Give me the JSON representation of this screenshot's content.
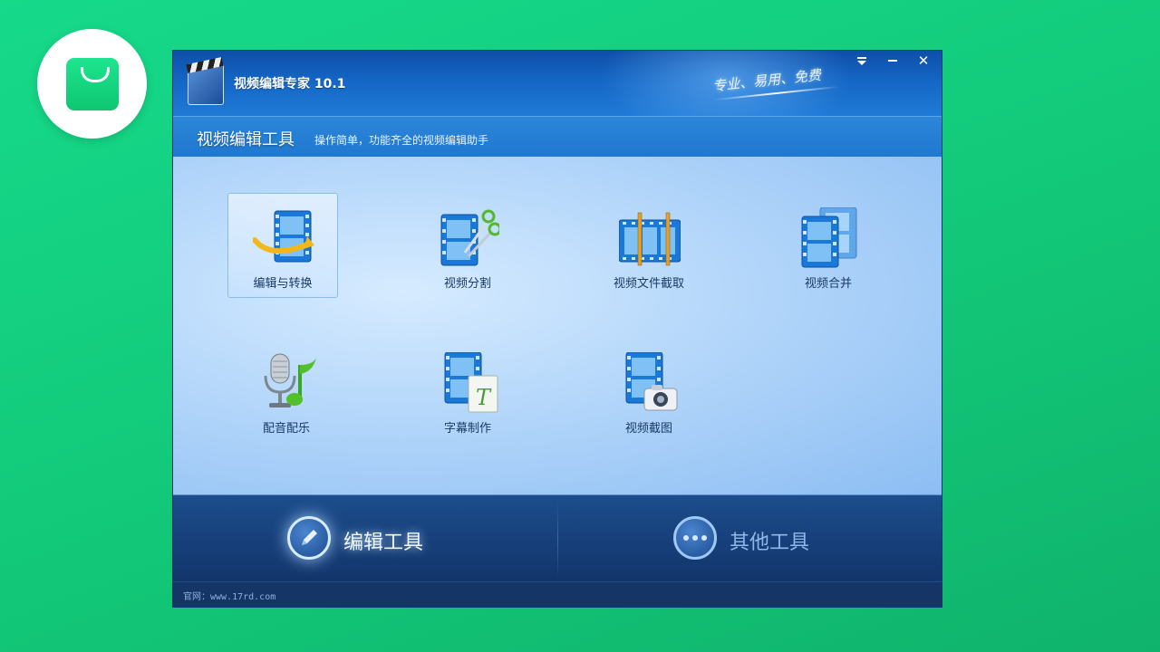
{
  "app": {
    "title": "视频编辑专家 10.1",
    "slogan": "专业、易用、免费"
  },
  "window_controls": {
    "dropdown_icon": "dropdown-arrow-icon",
    "minimize_icon": "minimize-icon",
    "close_label": "✕"
  },
  "header": {
    "title": "视频编辑工具",
    "subtitle": "操作简单，功能齐全的视频编辑助手"
  },
  "tools": [
    {
      "label": "编辑与转换",
      "icon": "film-convert-icon",
      "selected": true
    },
    {
      "label": "视频分割",
      "icon": "film-scissors-icon",
      "selected": false
    },
    {
      "label": "视频文件截取",
      "icon": "film-trim-icon",
      "selected": false
    },
    {
      "label": "视频合并",
      "icon": "film-merge-icon",
      "selected": false
    },
    {
      "label": "配音配乐",
      "icon": "microphone-music-icon",
      "selected": false
    },
    {
      "label": "字幕制作",
      "icon": "film-subtitle-icon",
      "selected": false
    },
    {
      "label": "视频截图",
      "icon": "film-camera-icon",
      "selected": false
    }
  ],
  "bottom_tabs": [
    {
      "label": "编辑工具",
      "icon": "pencil-icon",
      "active": true
    },
    {
      "label": "其他工具",
      "icon": "more-dots-icon",
      "active": false
    }
  ],
  "footer": {
    "website": "官网：www.17rd.com"
  },
  "colors": {
    "background": "#12c878",
    "titlebar": "#1466c4",
    "bottom_bar": "#163e78",
    "label_text": "#1a3a66"
  }
}
